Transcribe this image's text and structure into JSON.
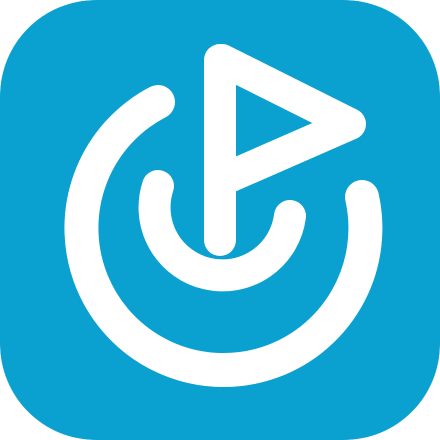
{
  "icon": {
    "name": "flag-target-app-icon",
    "background_color": "#0aa0cf",
    "foreground_color": "#ffffff"
  }
}
